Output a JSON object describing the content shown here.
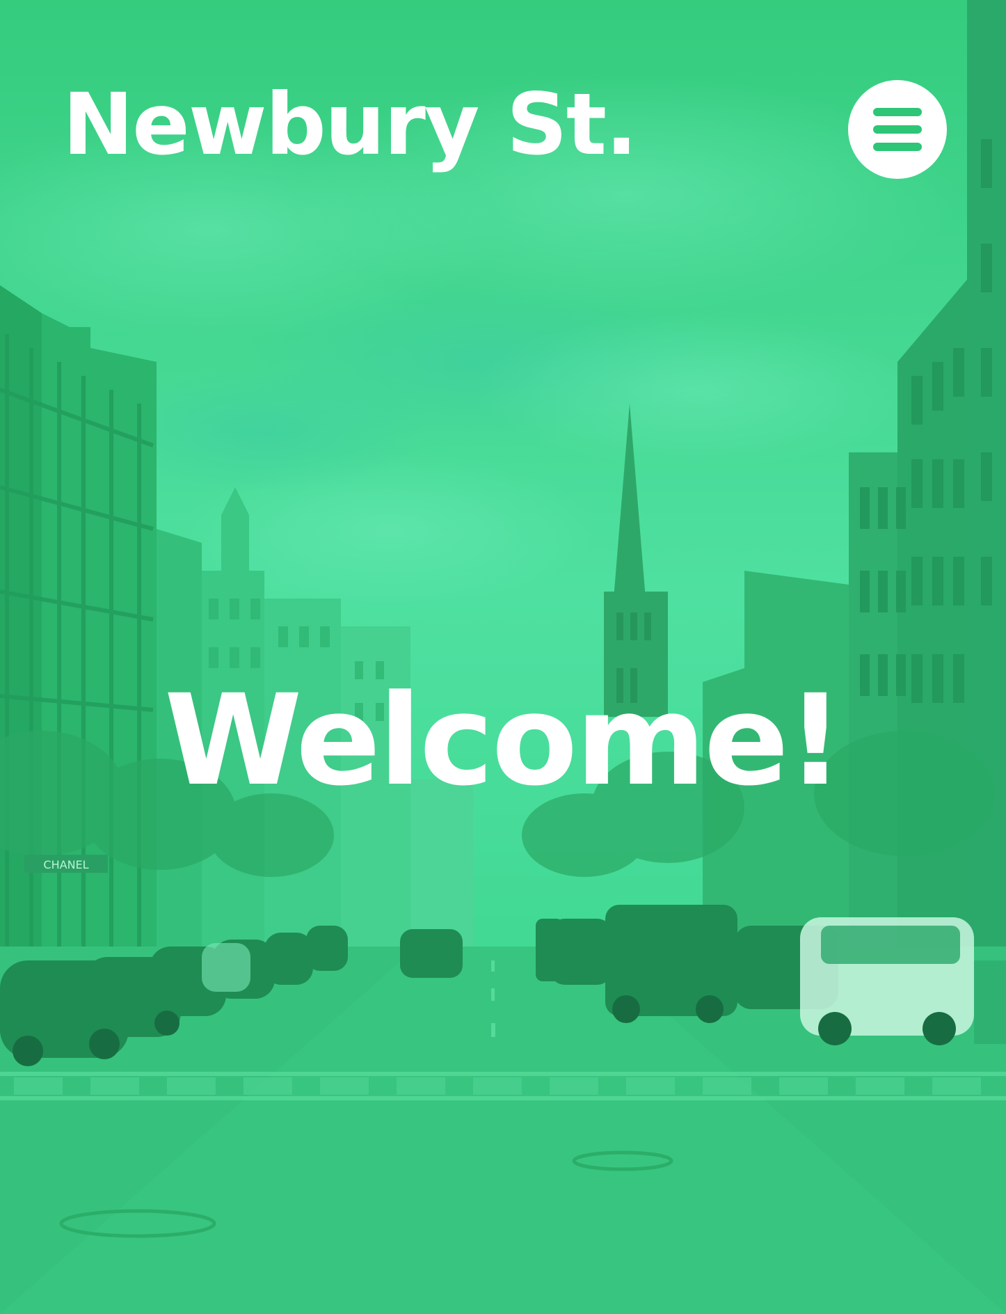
{
  "header": {
    "brand": "Newbury St.",
    "menu_icon": "hamburger-menu-icon"
  },
  "hero": {
    "headline": "Welcome!",
    "storefront_sign": "CHANEL"
  },
  "colors": {
    "accent": "#2cc676",
    "overlay_tint": "#34d48a",
    "text": "#ffffff"
  }
}
